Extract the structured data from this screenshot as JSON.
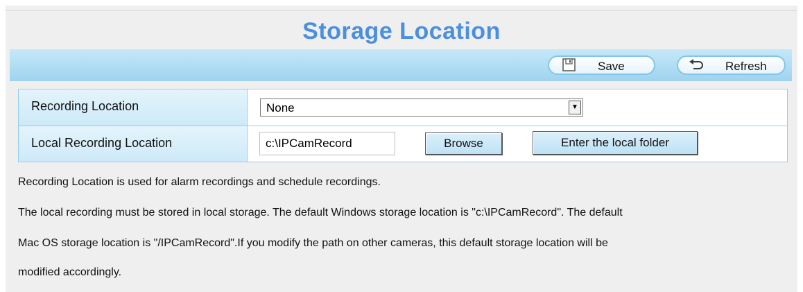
{
  "page": {
    "title": "Storage Location"
  },
  "toolbar": {
    "save_label": "Save",
    "refresh_label": "Refresh",
    "save_icon": "floppy-disk-icon",
    "refresh_icon": "refresh-arrow-icon"
  },
  "settings": {
    "recording_location": {
      "label": "Recording Location",
      "selected": "None"
    },
    "local_recording_location": {
      "label": "Local Recording Location",
      "value": "c:\\IPCamRecord",
      "browse_label": "Browse",
      "enter_folder_label": "Enter the local folder"
    }
  },
  "description": {
    "line1": "Recording Location is used for alarm recordings and schedule recordings.",
    "line2": "The local recording must be stored in local storage. The default Windows storage location is \"c:\\IPCamRecord\". The default",
    "line3": "Mac OS storage location is \"/IPCamRecord\".If you modify the path on other cameras, this default storage location will be",
    "line4": "modified accordingly."
  },
  "colors": {
    "title": "#4a8fe0",
    "toolbar": "#b4ddf3",
    "border": "#8fd0ef"
  }
}
